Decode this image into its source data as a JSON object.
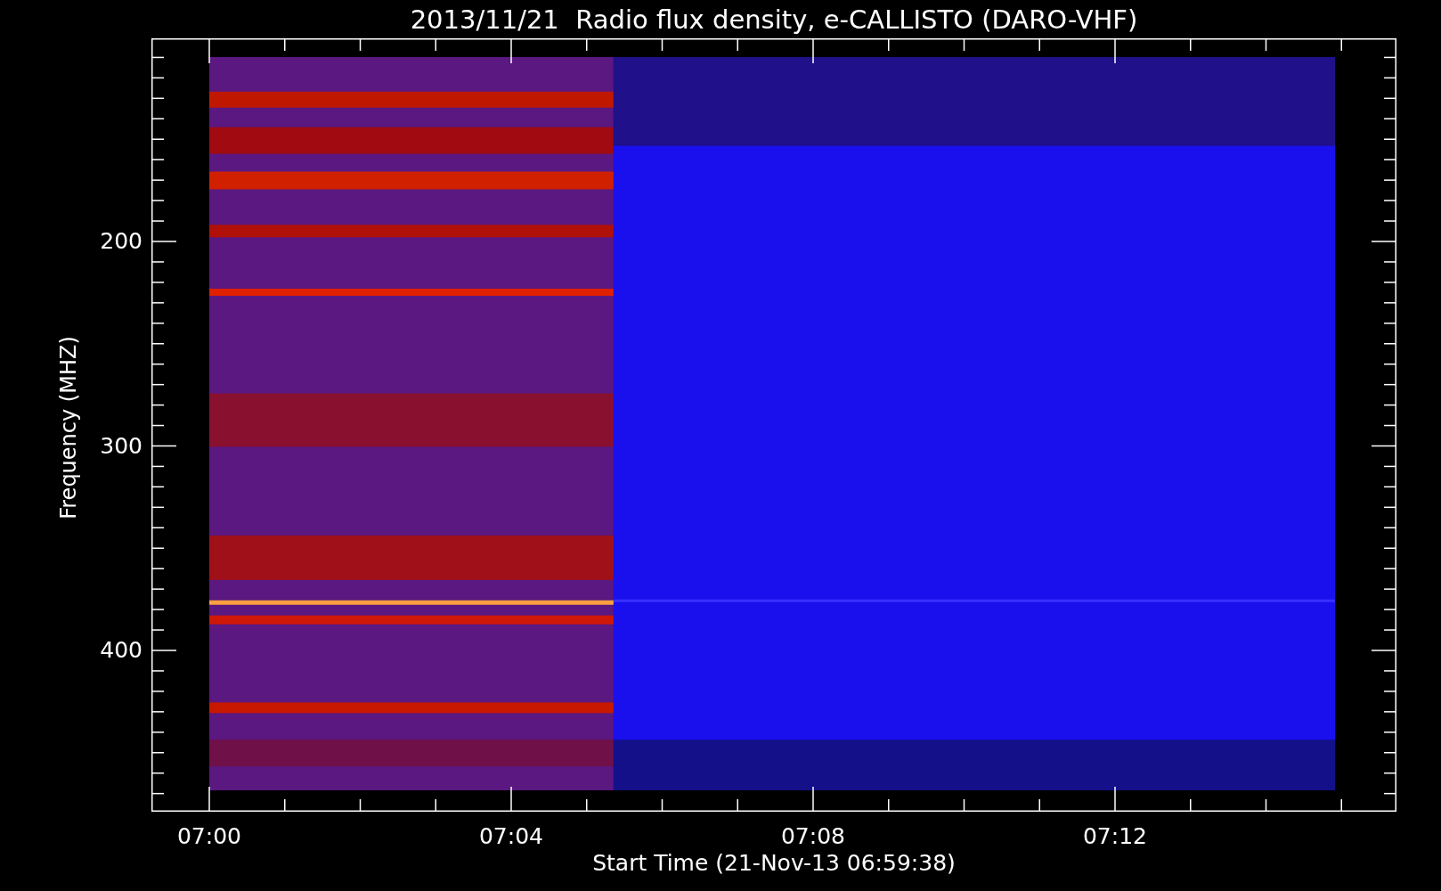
{
  "title": "2013/11/21  Radio flux density, e-CALLISTO (DARO-VHF)",
  "y_axis": {
    "label": "Frequency (MHZ)",
    "ticks": [
      "200",
      "300",
      "400"
    ]
  },
  "x_axis": {
    "label": "Start Time (21-Nov-13 06:59:38)",
    "ticks": [
      "07:00",
      "07:04",
      "07:08",
      "07:12"
    ]
  }
}
